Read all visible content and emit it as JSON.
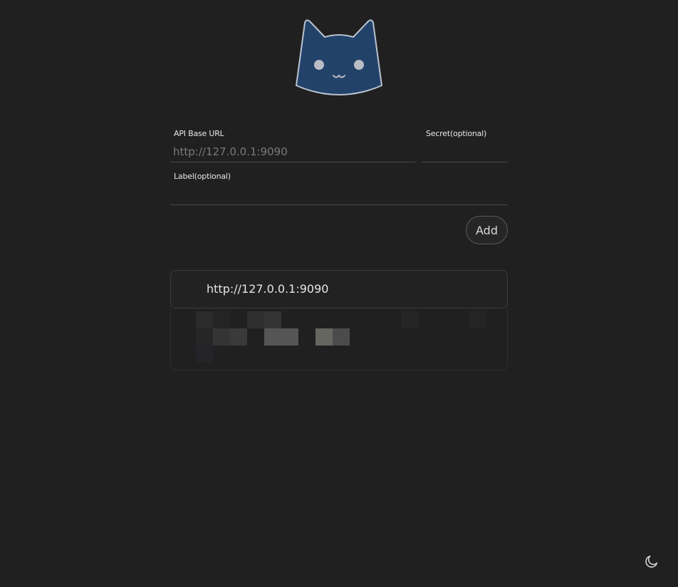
{
  "form": {
    "api_base_url_label": "API Base URL",
    "api_base_url_placeholder": "http://127.0.0.1:9090",
    "api_base_url_value": "",
    "secret_label": "Secret(optional)",
    "secret_value": "",
    "label_label": "Label(optional)",
    "label_value": "",
    "add_button_label": "Add"
  },
  "backends": [
    {
      "url": "http://127.0.0.1:9090"
    }
  ],
  "colors": {
    "background": "#202020",
    "logo_fill": "#23426a",
    "logo_stroke": "#b9c3cf"
  },
  "icons": {
    "logo": "cat-head-icon",
    "theme_toggle": "moon-icon"
  }
}
